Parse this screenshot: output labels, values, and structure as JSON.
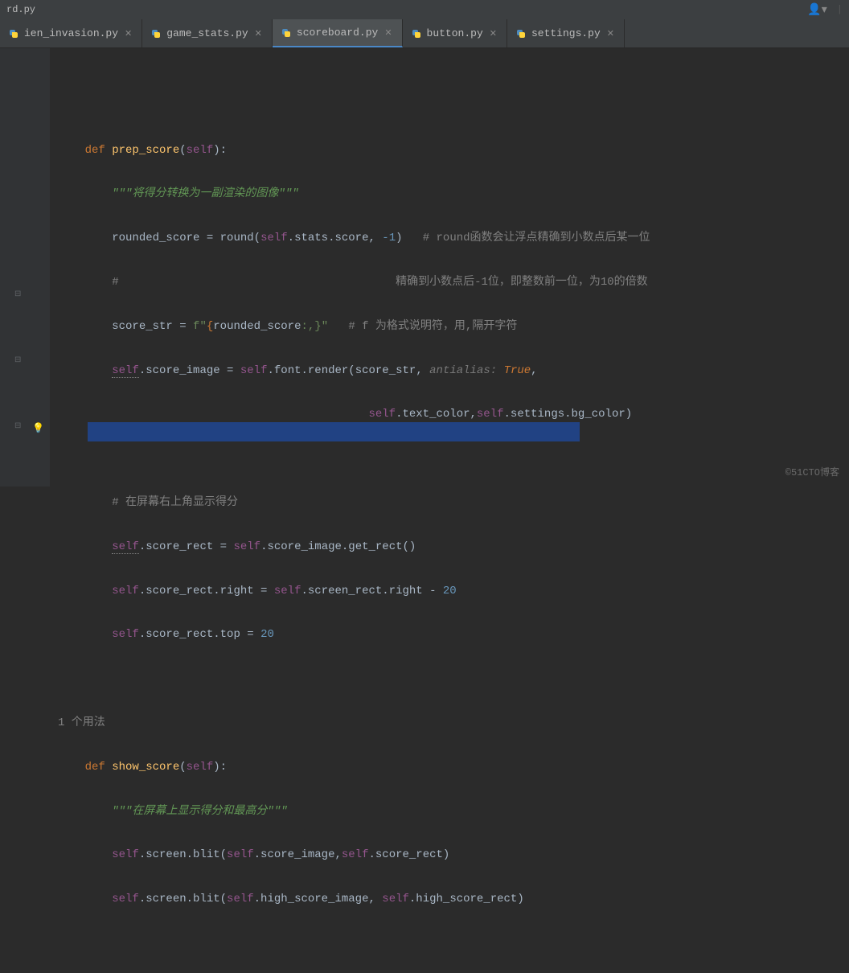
{
  "title_bar": {
    "path": "rd.py"
  },
  "tabs": [
    {
      "label": "ien_invasion.py",
      "active": false
    },
    {
      "label": "game_stats.py",
      "active": false
    },
    {
      "label": "scoreboard.py",
      "active": true
    },
    {
      "label": "button.py",
      "active": false
    },
    {
      "label": "settings.py",
      "active": false
    }
  ],
  "code": {
    "l1_def": "def ",
    "l1_fn": "prep_score",
    "l1_open": "(",
    "l1_self": "self",
    "l1_close": "):",
    "l2_doc": "\"\"\"将得分转换为一副渲染的图像\"\"\"",
    "l3_a": "rounded_score = ",
    "l3_round": "round",
    "l3_b": "(",
    "l3_self": "self",
    "l3_c": ".stats.score, ",
    "l3_num": "-1",
    "l3_d": ")   ",
    "l3_com": "# round函数会让浮点精确到小数点后某一位",
    "l4_a": "#                                         ",
    "l4_b": "精确到小数点后-1位，即整数前一位，为10的倍数",
    "l5_a": "score_str = ",
    "l5_f": "f\"",
    "l5_b": "{",
    "l5_c": "rounded_score",
    "l5_d": ":,}",
    "l5_e": "\"",
    "l5_sp": "   ",
    "l5_com": "# f 为格式说明符，用,隔开字符",
    "l6_self": "self",
    "l6_a": ".",
    "l6_si": "score_image",
    "l6_b": " = ",
    "l6_self2": "self",
    "l6_c": ".font.render(score_str",
    "l6_comma": ",",
    "l6_hint": " antialias: ",
    "l6_true": "True",
    "l6_d": ",",
    "l7_self": "self",
    "l7_a": ".text_color",
    "l7_comma": ",",
    "l7_self2": "self",
    "l7_b": ".settings.bg_color)",
    "l9_com": "# 在屏幕右上角显示得分",
    "l10_self": "self",
    "l10_a": ".",
    "l10_sr": "score_rect",
    "l10_b": " = ",
    "l10_self2": "self",
    "l10_c": ".score_image.get_rect()",
    "l11_self": "self",
    "l11_a": ".score_rect.right = ",
    "l11_self2": "self",
    "l11_b": ".screen_rect.right - ",
    "l11_num": "20",
    "l12_self": "self",
    "l12_a": ".score_rect.top = ",
    "l12_num": "20",
    "usage": "1 个用法",
    "l15_def": "def ",
    "l15_fn": "show_score",
    "l15_a": "(",
    "l15_self": "self",
    "l15_b": "):",
    "l16_doc": "\"\"\"在屏幕上显示得分和最高分\"\"\"",
    "l17_self": "self",
    "l17_a": ".screen.blit(",
    "l17_self2": "self",
    "l17_b": ".score_image",
    "l17_comma": ",",
    "l17_self3": "self",
    "l17_c": ".score_rect)",
    "l18_self": "self",
    "l18_a": ".screen.blit(",
    "l18_self2": "self",
    "l18_b": ".high_score_image, ",
    "l18_self3": "self",
    "l18_c": ".high_score_rect)"
  },
  "watermark": "©51CTO博客"
}
